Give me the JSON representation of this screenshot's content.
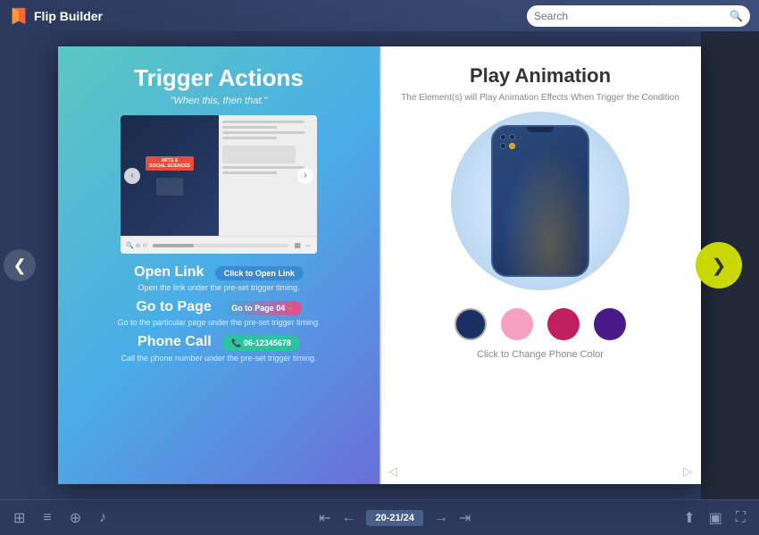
{
  "header": {
    "logo_text": "Flip Builder",
    "search_placeholder": "Search"
  },
  "left_page": {
    "title": "Trigger Actions",
    "subtitle": "\"When this, then that.\"",
    "mini_viewer": {
      "prev_btn": "‹",
      "next_btn": "›",
      "book_badge_line1": "ARTS &",
      "book_badge_line2": "SOCIAL SCIENCES"
    },
    "actions": [
      {
        "title": "Open Link",
        "btn_label": "Click to Open Link",
        "desc": "Open the link under the pre-set trigger timing."
      },
      {
        "title": "Go to Page",
        "btn_label": "Go to Page 04 ●",
        "desc": "Go to the particular page under the pre-set trigger timing."
      },
      {
        "title": "Phone Call",
        "btn_label": "06-12345678",
        "desc": "Call the phone number under the pre-set trigger timing."
      }
    ]
  },
  "right_page": {
    "title": "Play Animation",
    "desc": "The Element(s) will Play Animation Effects When Trigger the Condition",
    "color_swatches": [
      {
        "color": "#1a3060",
        "label": "Navy"
      },
      {
        "color": "#f8a0c0",
        "label": "Pink Light"
      },
      {
        "color": "#c02060",
        "label": "Rose"
      },
      {
        "color": "#4a1a8a",
        "label": "Purple"
      }
    ],
    "color_caption": "Click to Change Phone Color"
  },
  "navigation": {
    "nav_left_arrow": "❮",
    "nav_right_arrow": "❯",
    "page_indicator": "20-21/24",
    "first_btn": "⇤",
    "prev_btn": "←",
    "next_btn": "→",
    "last_btn": "⇥"
  },
  "bottom_toolbar": {
    "grid_icon": "⊞",
    "list_icon": "≡",
    "zoom_icon": "⊕",
    "audio_icon": "♪",
    "share_icon": "⬆",
    "screen_icon": "▣",
    "fullscreen_icon": "⛶",
    "page_turn_left": "◁",
    "page_turn_right": "▷"
  }
}
